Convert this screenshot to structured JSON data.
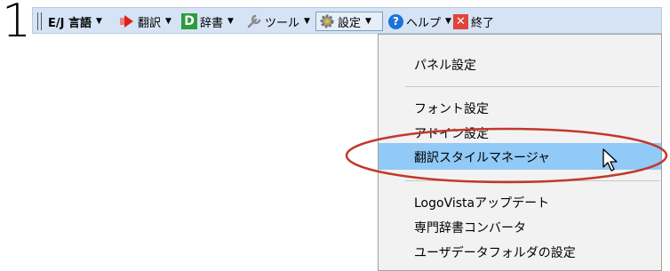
{
  "step_number": "1",
  "toolbar": {
    "items": [
      {
        "label": "E/J 言語",
        "caret": "▼"
      },
      {
        "label": "翻訳",
        "caret": "▼"
      },
      {
        "label": "辞書",
        "caret": "▼"
      },
      {
        "label": "ツール",
        "caret": "▼"
      },
      {
        "label": "設定",
        "caret": "▼"
      },
      {
        "label": "ヘルプ",
        "caret": "▼"
      },
      {
        "label": "終了",
        "caret": ""
      }
    ],
    "dict_badge": "D",
    "active_item": "設定"
  },
  "settings_menu": {
    "items": [
      "パネル設定",
      "フォント設定",
      "アドイン設定",
      "翻訳スタイルマネージャ",
      "LogoVistaアップデート",
      "専門辞書コンバータ",
      "ユーザデータフォルダの設定"
    ],
    "highlighted": "翻訳スタイルマネージャ"
  },
  "colors": {
    "toolbar_bg": "#d5e3f5",
    "menu_bg": "#f2f2f2",
    "highlight": "#91c9f7",
    "annotation_ellipse": "#c0392b"
  },
  "icons": [
    "play-arrow-icon",
    "dictionary-icon",
    "wrench-icon",
    "gear-icon",
    "help-icon",
    "close-icon",
    "mouse-cursor-icon"
  ]
}
